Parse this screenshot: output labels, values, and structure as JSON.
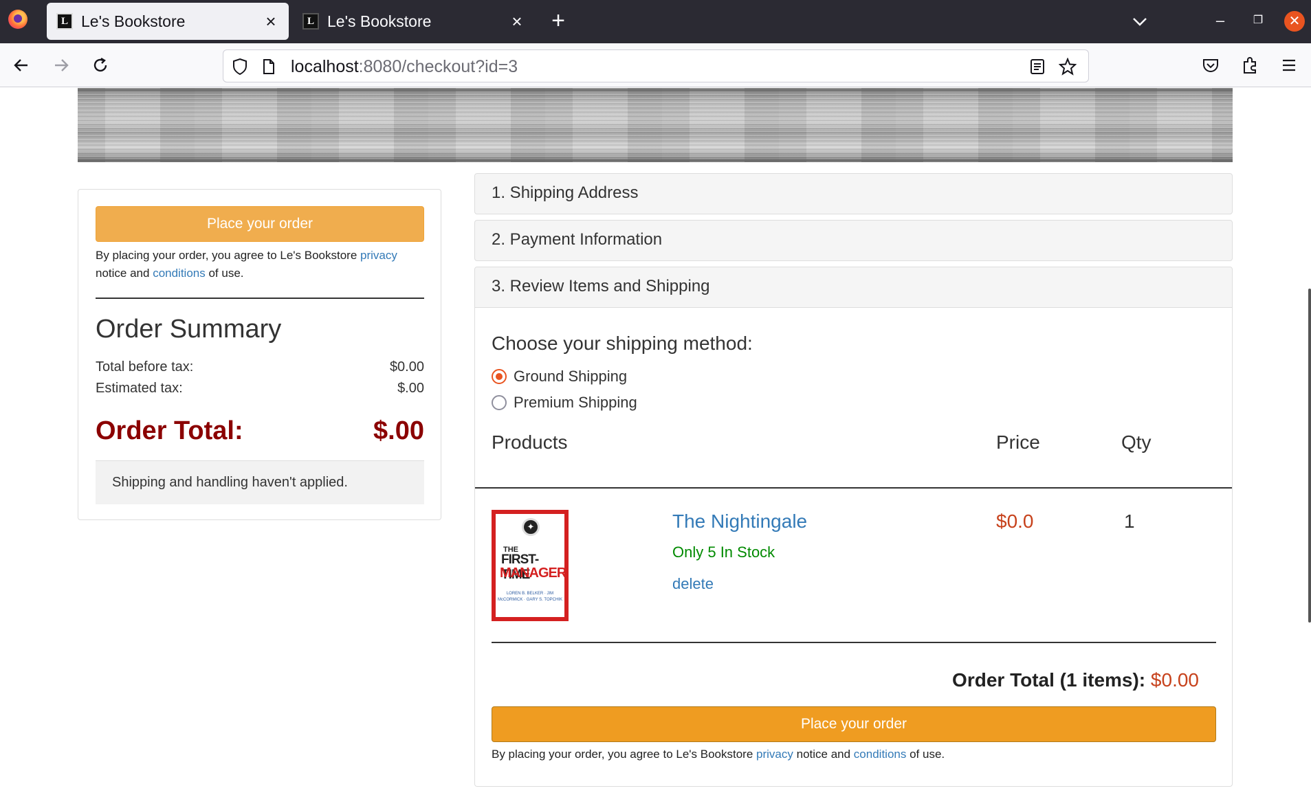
{
  "browser": {
    "tabs": [
      {
        "title": "Le's Bookstore",
        "favicon": "L",
        "active": true
      },
      {
        "title": "Le's Bookstore",
        "favicon": "L",
        "active": false
      }
    ],
    "url_host": "localhost",
    "url_rest": ":8080/checkout?id=3"
  },
  "summary": {
    "place_order_label": "Place your order",
    "agree_prefix": "By placing your order, you agree to Le's Bookstore ",
    "privacy_link": "privacy",
    "agree_middle": " notice and ",
    "conditions_link": "conditions",
    "agree_suffix": " of use.",
    "title": "Order Summary",
    "total_before_tax_label": "Total before tax:",
    "total_before_tax_value": "$0.00",
    "estimated_tax_label": "Estimated tax:",
    "estimated_tax_value": "$.00",
    "order_total_label": "Order Total:",
    "order_total_value": "$.00",
    "shipping_note": "Shipping and handling haven't applied."
  },
  "steps": {
    "shipping_address": "1. Shipping Address",
    "payment_information": "2. Payment Information",
    "review_items": "3. Review Items and Shipping"
  },
  "review": {
    "ship_method_title": "Choose your shipping method:",
    "ship_options": [
      {
        "label": "Ground Shipping",
        "checked": true
      },
      {
        "label": "Premium Shipping",
        "checked": false
      }
    ],
    "columns": {
      "products": "Products",
      "price": "Price",
      "qty": "Qty"
    },
    "items": [
      {
        "title": "The Nightingale",
        "stock": "Only 5 In Stock",
        "delete_label": "delete",
        "price": "$0.0",
        "qty": "1",
        "cover": {
          "top_line": "THE",
          "line1": "FIRST-TIME",
          "line2": "MANAGER",
          "authors": "LOREN B. BELKER · JIM McCORMICK · GARY S. TOPCHIK"
        }
      }
    ],
    "grand_total_label": "Order Total (1 items):",
    "grand_total_value": "$0.00",
    "place_order_label": "Place your order",
    "agree_prefix": "By placing your order, you agree to Le's Bookstore ",
    "privacy_link": "privacy",
    "agree_middle": " notice and ",
    "conditions_link": "conditions",
    "agree_suffix": " of use."
  },
  "colors": {
    "accent_orange": "#f0ad4e",
    "button_orange": "#ef9c21",
    "link_blue": "#337ab7",
    "total_red": "#8b0000",
    "price_red": "#c7421c",
    "stock_green": "#008a00"
  }
}
